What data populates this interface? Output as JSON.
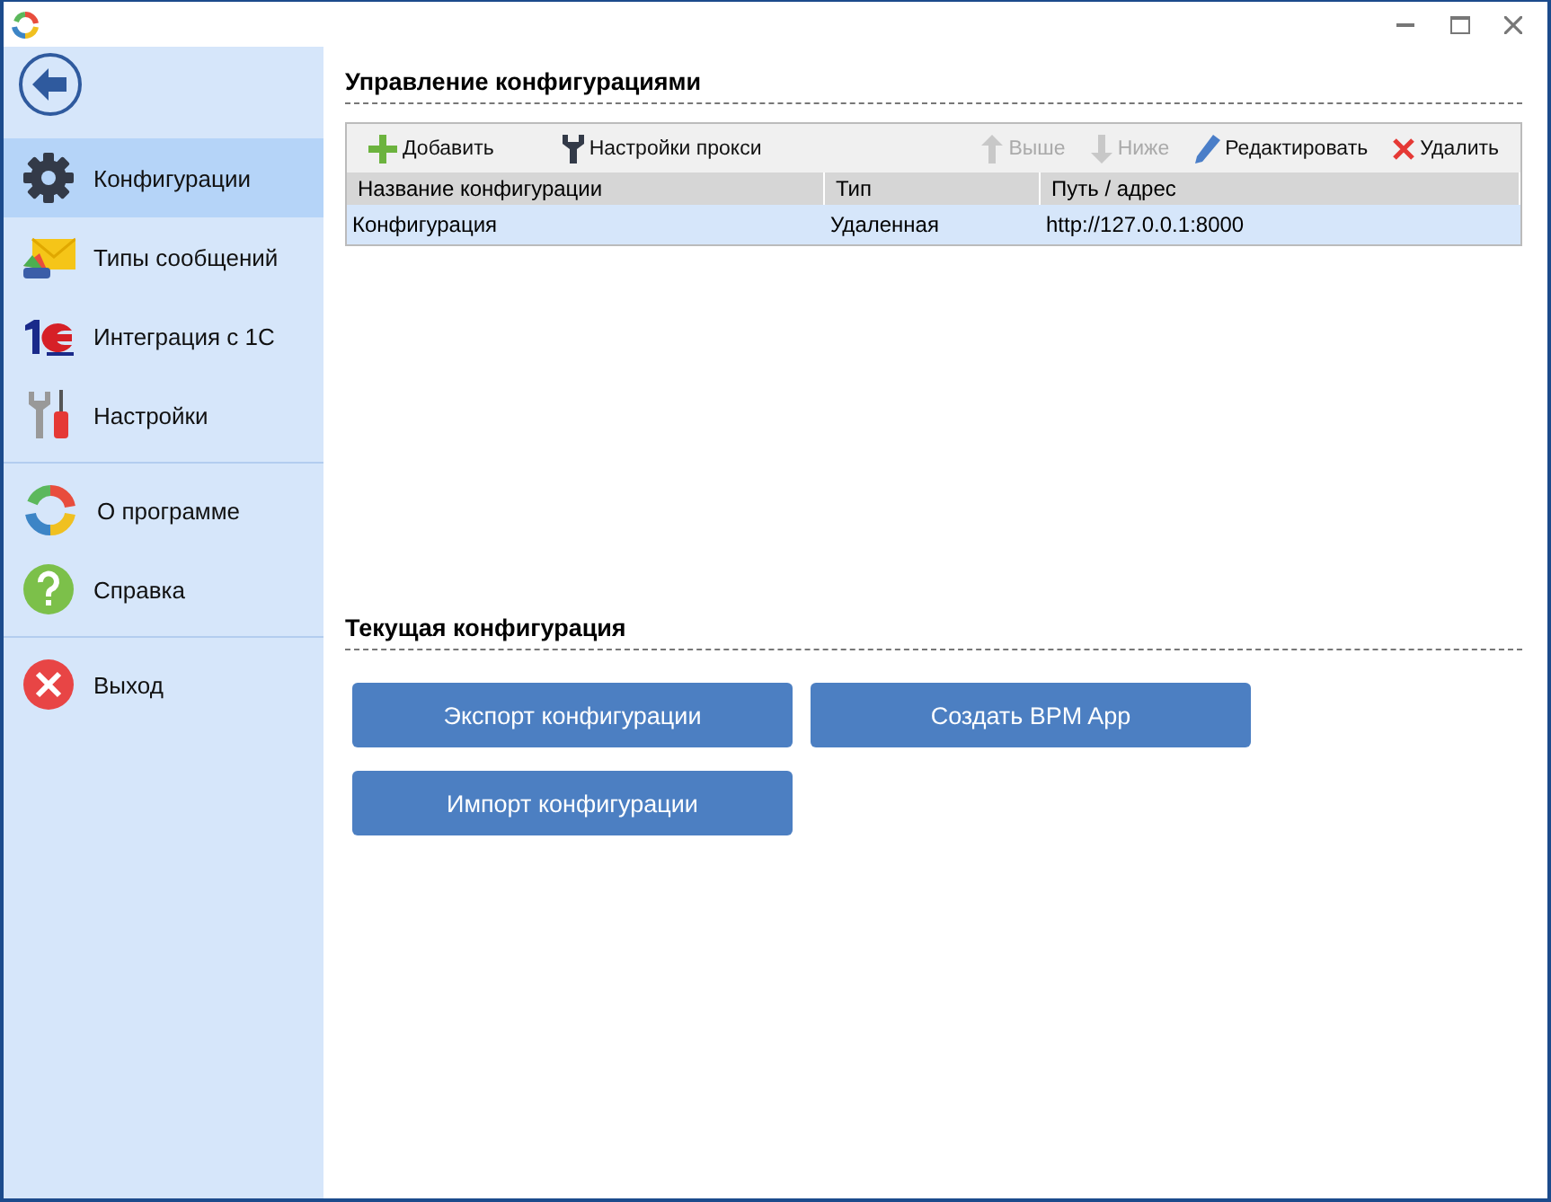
{
  "sidebar": {
    "sections": [
      [
        {
          "label": "Конфигурации",
          "selected": true
        },
        {
          "label": "Типы сообщений",
          "selected": false
        },
        {
          "label": "Интеграция с 1С",
          "selected": false
        },
        {
          "label": "Настройки",
          "selected": false
        }
      ],
      [
        {
          "label": "О программе",
          "selected": false
        },
        {
          "label": "Справка",
          "selected": false
        }
      ],
      [
        {
          "label": "Выход",
          "selected": false
        }
      ]
    ]
  },
  "config_management": {
    "title": "Управление конфигурациями",
    "toolbar": {
      "left": [
        {
          "label": "Добавить",
          "disabled": false
        },
        {
          "label": "Настройки прокси",
          "disabled": false
        }
      ],
      "right": [
        {
          "label": "Выше",
          "disabled": true
        },
        {
          "label": "Ниже",
          "disabled": true
        },
        {
          "label": "Редактировать",
          "disabled": false
        },
        {
          "label": "Удалить",
          "disabled": false
        }
      ]
    },
    "table": {
      "columns": [
        "Название конфигурации",
        "Тип",
        "Путь / адрес"
      ],
      "rows": [
        {
          "cells": [
            "Конфигурация",
            "Удаленная",
            "http://127.0.0.1:8000"
          ],
          "selected": true
        }
      ]
    }
  },
  "current_config": {
    "title": "Текущая конфигурация",
    "buttons": [
      [
        "Экспорт конфигурации",
        "Создать BPM App"
      ],
      [
        "Импорт конфигурации"
      ]
    ]
  }
}
